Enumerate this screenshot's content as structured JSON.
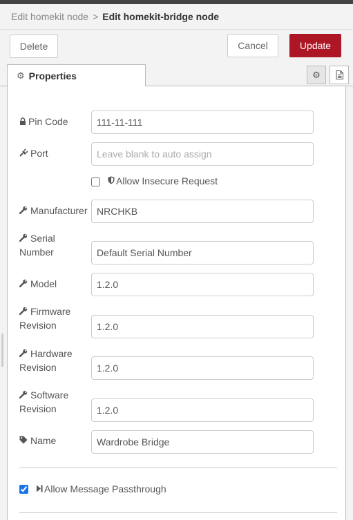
{
  "breadcrumb": {
    "parent": "Edit homekit node",
    "separator": ">",
    "current": "Edit homekit-bridge node"
  },
  "toolbar": {
    "delete_label": "Delete",
    "cancel_label": "Cancel",
    "update_label": "Update"
  },
  "tabs": {
    "properties_label": "Properties"
  },
  "form": {
    "pin_code": {
      "label": "Pin Code",
      "value": "111-11-111"
    },
    "port": {
      "label": "Port",
      "value": "",
      "placeholder": "Leave blank to auto assign"
    },
    "allow_insecure": {
      "label": "Allow Insecure Request",
      "checked": false
    },
    "manufacturer": {
      "label": "Manufacturer",
      "value": "NRCHKB"
    },
    "serial_number": {
      "label_line1": "Serial",
      "label_line2": "Number",
      "value": "Default Serial Number"
    },
    "model": {
      "label": "Model",
      "value": "1.2.0"
    },
    "firmware_revision": {
      "label_line1": "Firmware",
      "label_line2": "Revision",
      "value": "1.2.0"
    },
    "hardware_revision": {
      "label_line1": "Hardware",
      "label_line2": "Revision",
      "value": "1.2.0"
    },
    "software_revision": {
      "label_line1": "Software",
      "label_line2": "Revision",
      "value": "1.2.0"
    },
    "name": {
      "label": "Name",
      "value": "Wardrobe Bridge"
    },
    "allow_passthrough": {
      "label": "Allow Message Passthrough",
      "checked": true
    }
  },
  "icons": {
    "lock": "lock-icon",
    "plug": "plug-icon",
    "shield": "shield-icon",
    "wrench": "wrench-icon",
    "tag": "tag-icon",
    "step_forward": "step-forward-icon",
    "gear": "gear-icon",
    "document": "document-icon"
  },
  "colors": {
    "update_button": "#ad1625",
    "checkbox_accent": "#1a73e8"
  }
}
